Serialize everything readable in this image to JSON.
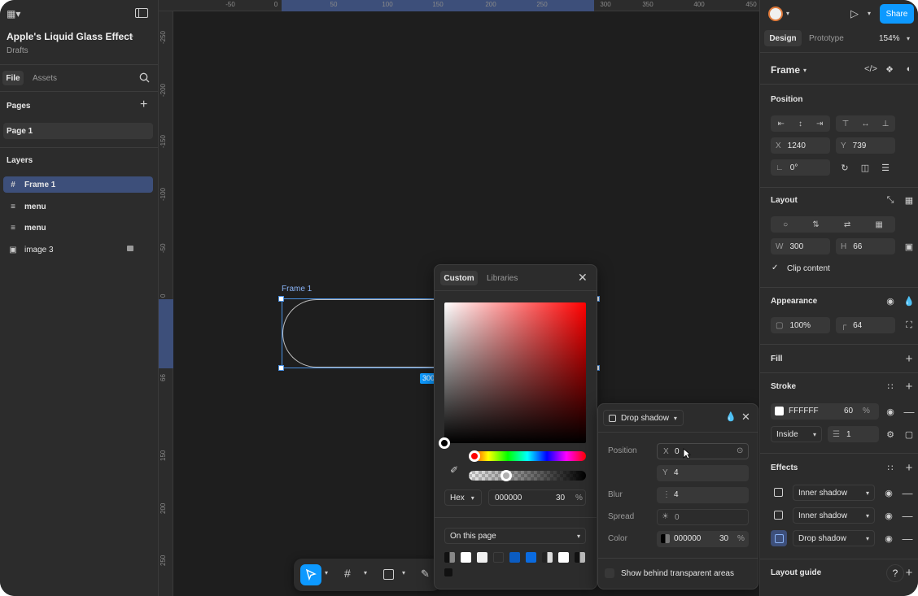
{
  "file": {
    "title": "Apple's Liquid Glass Effect",
    "location": "Drafts",
    "tabs": [
      "File",
      "Assets"
    ],
    "pages_heading": "Pages",
    "pages": [
      "Page 1"
    ],
    "layers_heading": "Layers",
    "layers": [
      {
        "name": "Frame 1",
        "icon": "frame-icon"
      },
      {
        "name": "menu",
        "icon": "component-icon"
      },
      {
        "name": "menu",
        "icon": "component-icon"
      },
      {
        "name": "image 3",
        "icon": "image-icon"
      }
    ]
  },
  "ruler": {
    "top": [
      "-50",
      "0",
      "50",
      "100",
      "150",
      "200",
      "250",
      "300",
      "350",
      "400",
      "450"
    ],
    "left": [
      "-250",
      "-200",
      "-150",
      "-100",
      "-50",
      "0",
      "66",
      "150",
      "200",
      "250"
    ]
  },
  "canvas": {
    "frame_label": "Frame 1",
    "width_badge": "300"
  },
  "header": {
    "share": "Share",
    "tabs": [
      "Design",
      "Prototype"
    ],
    "zoom": "154%"
  },
  "design": {
    "selection": "Frame",
    "position_heading": "Position",
    "x_label": "X",
    "x": "1240",
    "y_label": "Y",
    "y": "739",
    "rotation": "0°",
    "layout_heading": "Layout",
    "w_label": "W",
    "w": "300",
    "h_label": "H",
    "h": "66",
    "clip_content": "Clip content",
    "appearance_heading": "Appearance",
    "opacity": "100%",
    "radius": "64",
    "fill_heading": "Fill",
    "stroke_heading": "Stroke",
    "stroke_hex": "FFFFFF",
    "stroke_opacity": "60",
    "stroke_pct": "%",
    "stroke_position": "Inside",
    "stroke_weight": "1",
    "effects_heading": "Effects",
    "effects": [
      "Inner shadow",
      "Inner shadow",
      "Drop shadow"
    ],
    "layout_guide": "Layout guide"
  },
  "color_picker": {
    "tabs": [
      "Custom",
      "Libraries"
    ],
    "mode": "Hex",
    "hex": "000000",
    "opacity": "30",
    "pct": "%",
    "scope": "On this page"
  },
  "shadow_popup": {
    "type": "Drop shadow",
    "position_label": "Position",
    "x_label": "X",
    "x": "0",
    "y_label": "Y",
    "y": "4",
    "blur_label": "Blur",
    "blur": "4",
    "spread_label": "Spread",
    "spread": "0",
    "color_label": "Color",
    "color_hex": "000000",
    "color_opacity": "30",
    "color_pct": "%",
    "show_behind": "Show behind transparent areas"
  },
  "colors": {
    "accent": "#0d99ff",
    "selection_bg": "#3d4f7a",
    "panel": "#2c2c2c",
    "canvas": "#1e1e1e"
  }
}
